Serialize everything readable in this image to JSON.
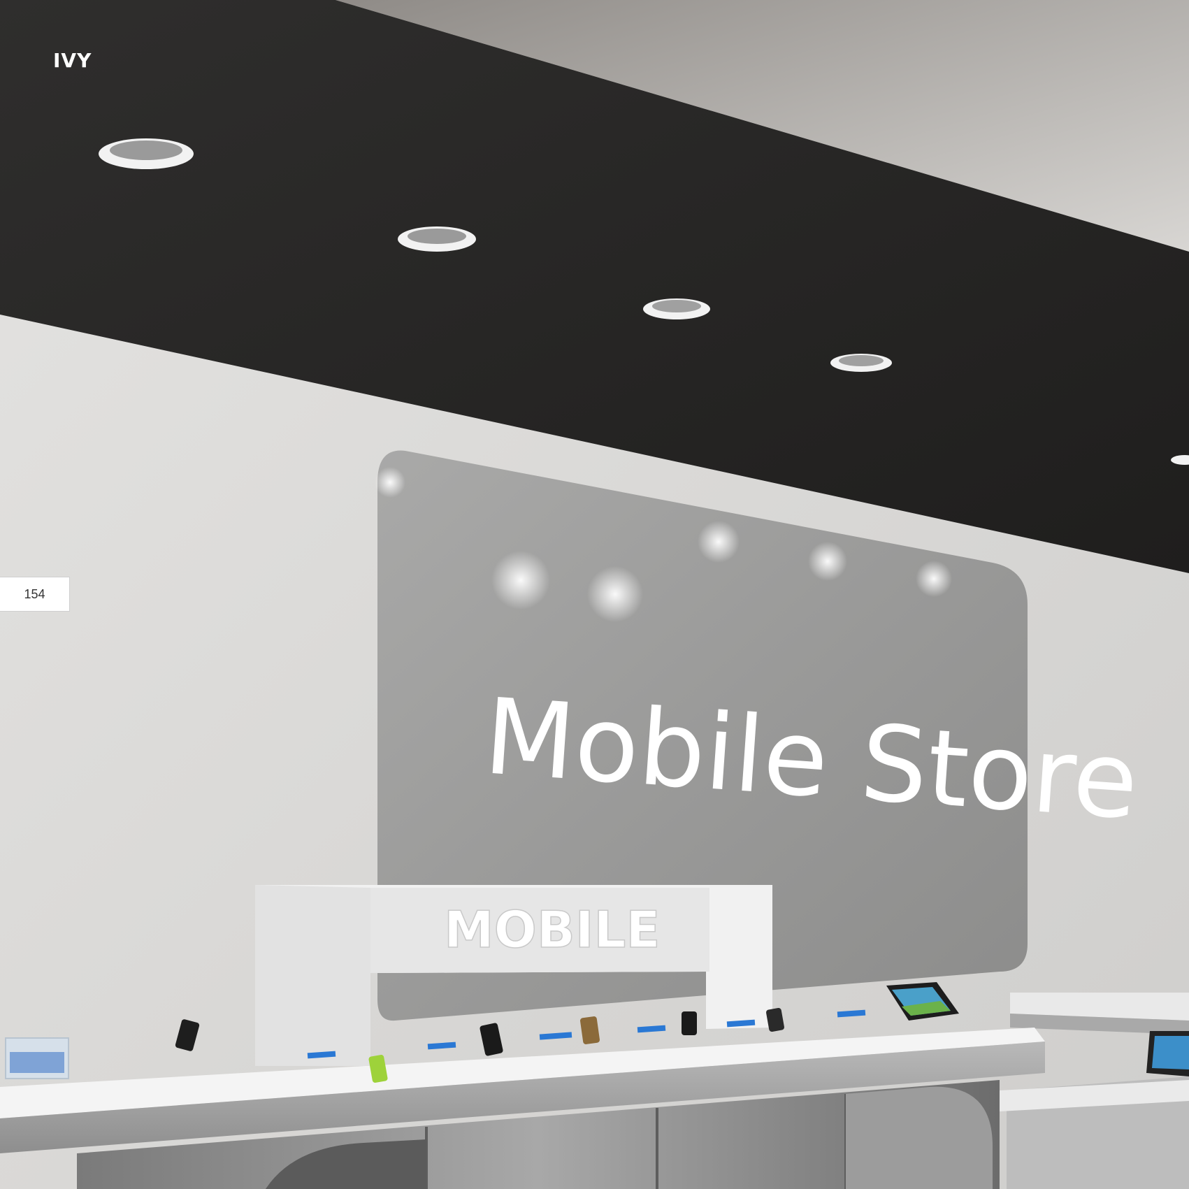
{
  "brand": {
    "name": "IVY"
  },
  "page": {
    "number": "154"
  },
  "scene": {
    "wall_sign": "Mobile Store",
    "counter_sign": "MOBILE"
  },
  "colors": {
    "ceiling": "#2b2a29",
    "wall": "#dcdbd9",
    "upper_wall": "#bfbcb8",
    "sign_panel": "#9b9b9a",
    "counter": "#eeeeee",
    "accent_blue": "#2a78d4"
  }
}
